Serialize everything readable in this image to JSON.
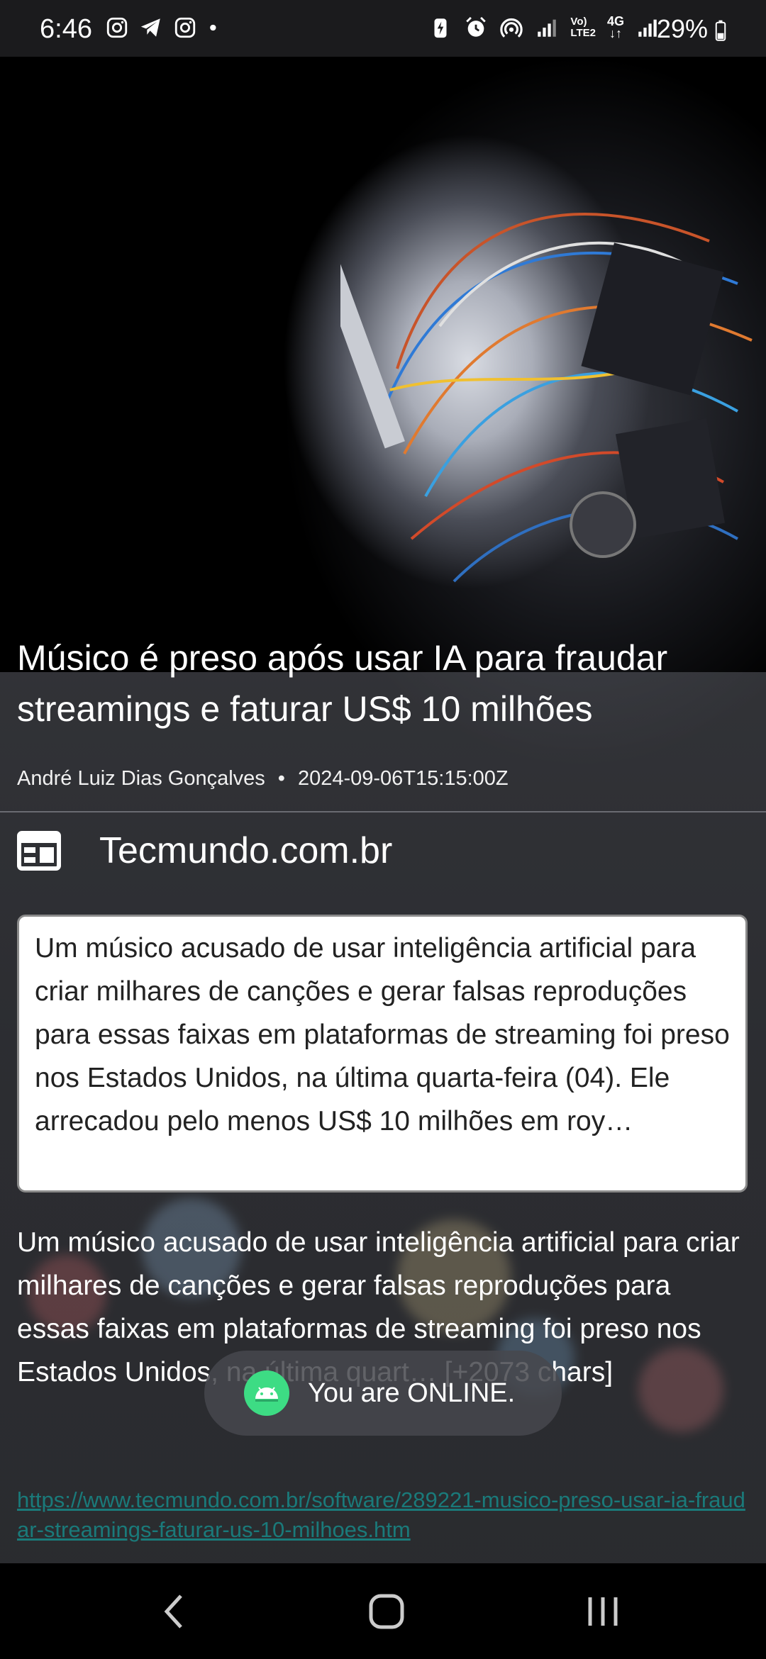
{
  "status_bar": {
    "time": "6:46",
    "notification_icons": [
      "instagram-icon",
      "telegram-icon",
      "instagram-icon",
      "dot-icon"
    ],
    "system_icons": [
      "battery-saver-icon",
      "alarm-icon",
      "hotspot-icon",
      "signal-icon",
      "volte-icon",
      "4g-icon",
      "signal-icon"
    ],
    "network_label_1": "Vo)",
    "network_label_2": "LTE2",
    "network_label_3": "4G",
    "battery_percent": "29%"
  },
  "article": {
    "title": "Músico é preso após usar IA para fraudar streamings e faturar US$ 10 milhões",
    "author": "André Luiz Dias Gonçalves",
    "separator": "•",
    "published_at": "2024-09-06T15:15:00Z",
    "source": "Tecmundo.com.br",
    "summary": "Um músico acusado de usar inteligência artificial para criar milhares de canções e gerar falsas reproduções para essas faixas em plataformas de streaming foi preso nos Estados Unidos, na última quarta-feira (04). Ele arrecadou pelo menos US$ 10 milhões em roy…",
    "content": "Um músico acusado de usar inteligência artificial para criar milhares de canções e gerar falsas reproduções para essas faixas em plataformas de streaming foi preso nos Estados Unidos, na última quart… [+2073 chars]",
    "url": "https://www.tecmundo.com.br/software/289221-musico-preso-usar-ia-fraudar-streamings-faturar-us-10-milhoes.htm"
  },
  "toast": {
    "message": "You are ONLINE."
  },
  "colors": {
    "status_bar_bg": "#1b1b1d",
    "link": "#1a7a7a",
    "toast_bg": "#46484e"
  }
}
